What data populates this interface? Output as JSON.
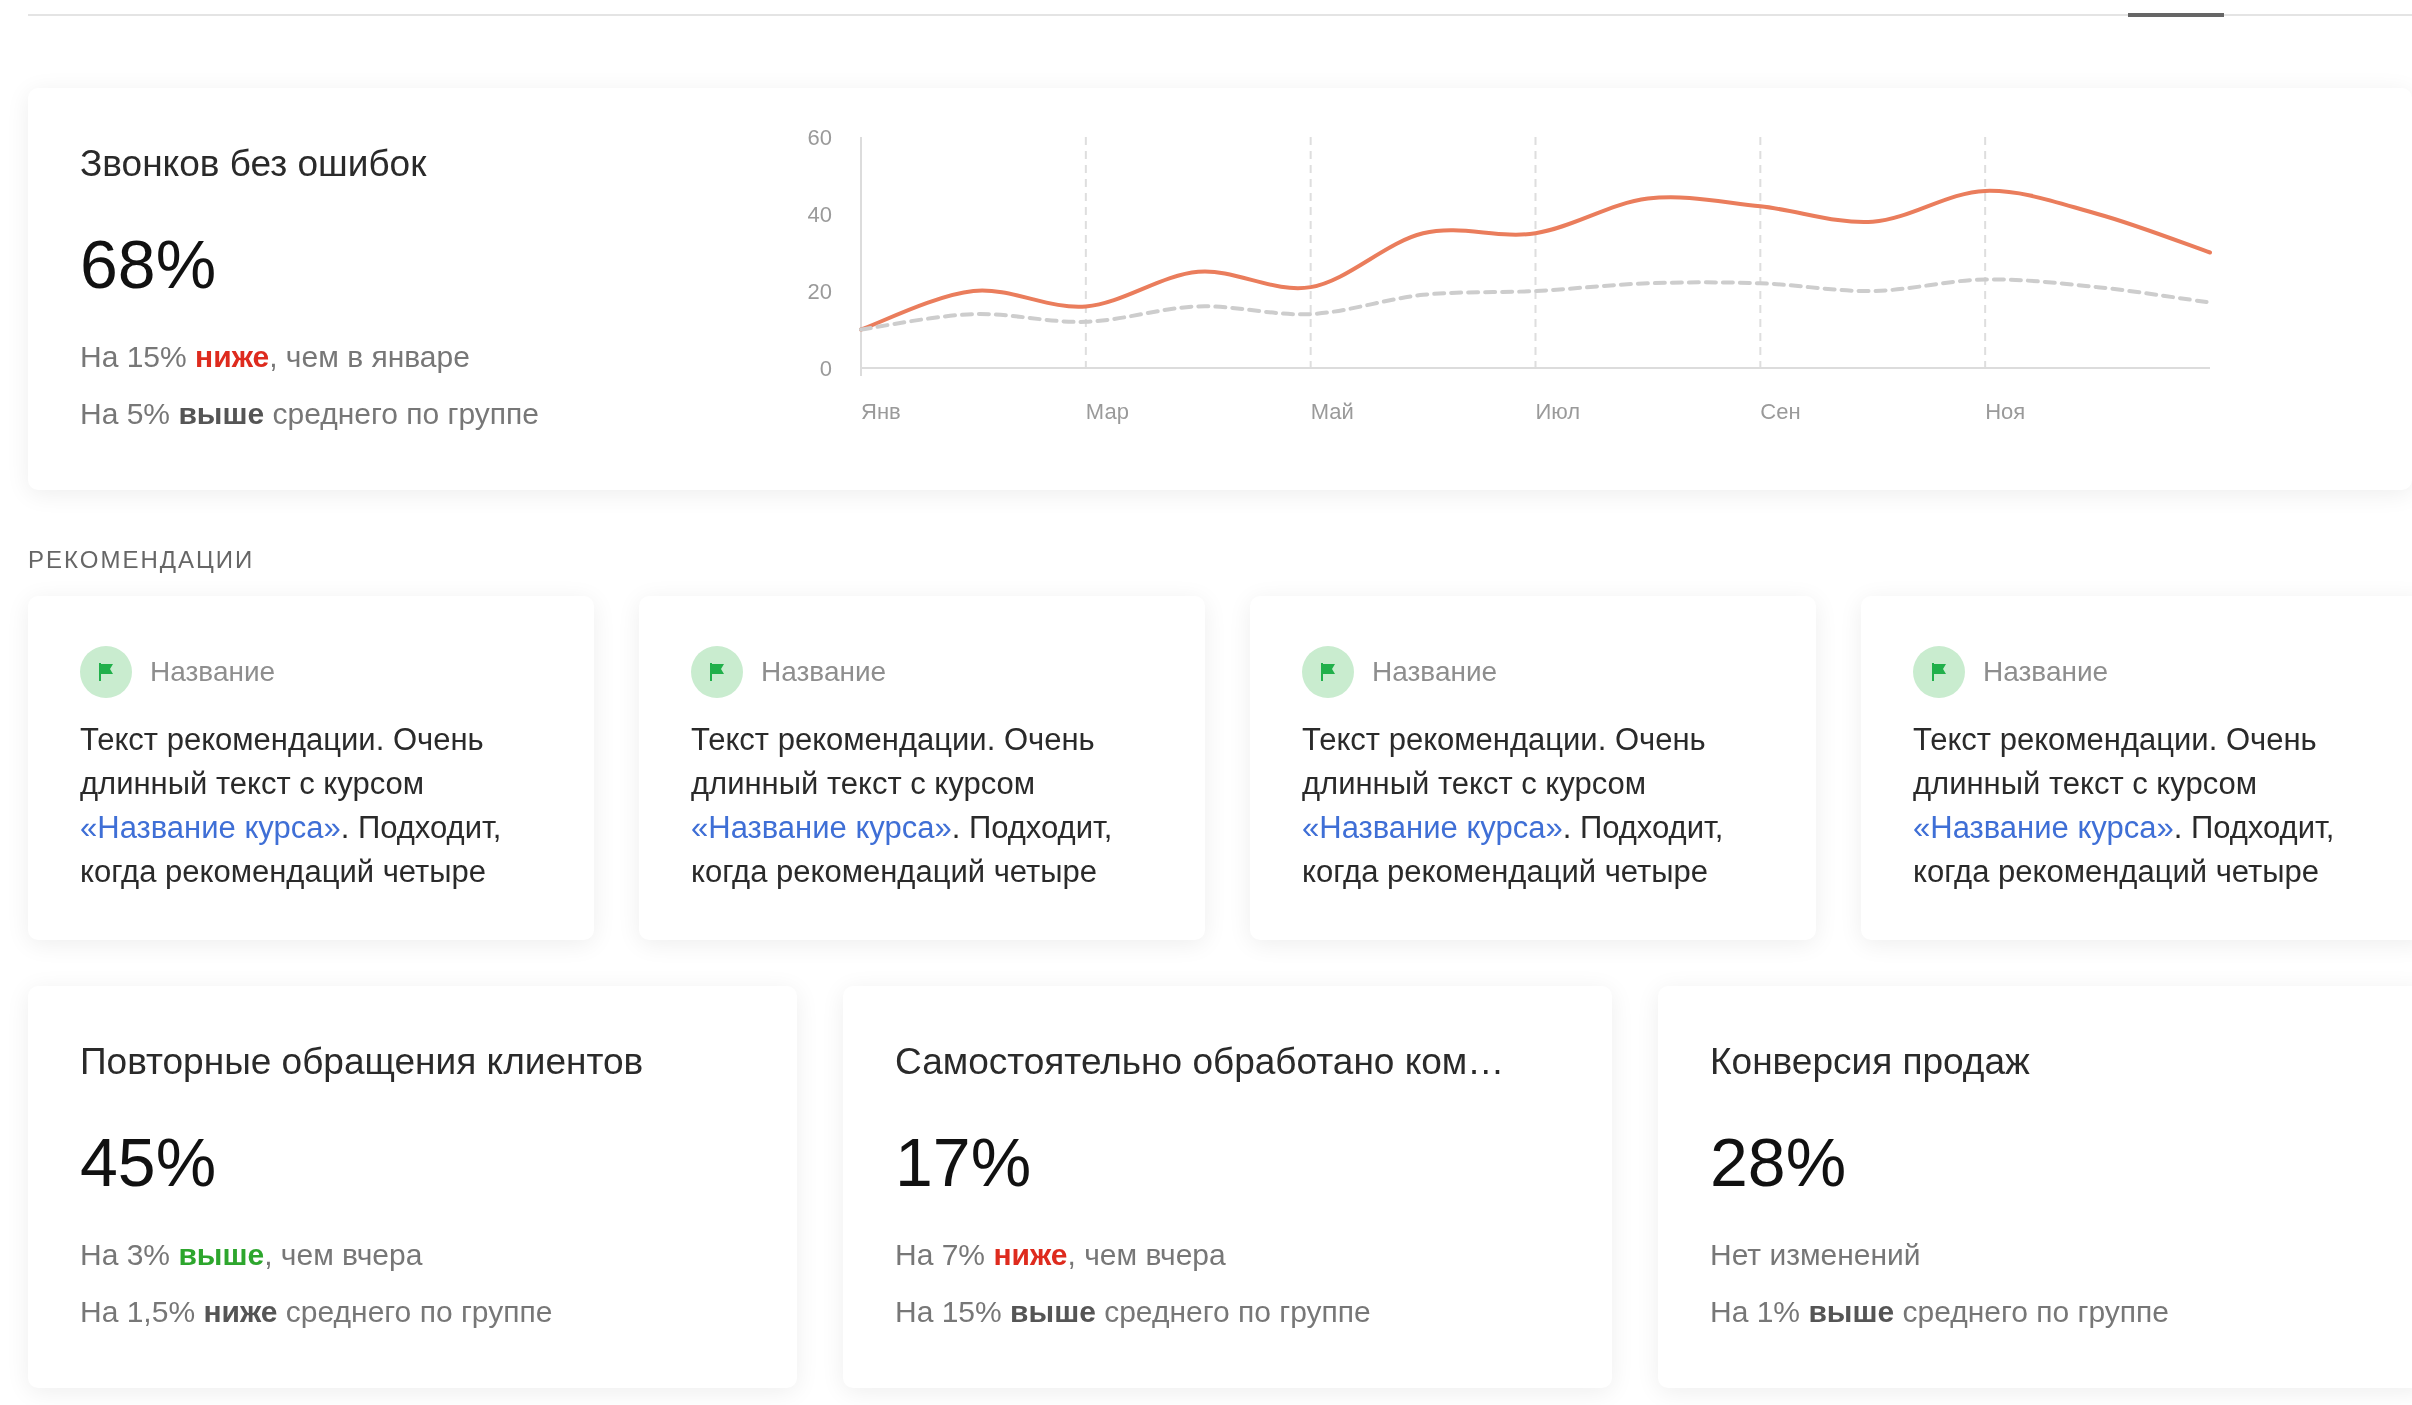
{
  "main_metric": {
    "title": "Звонков без ошибок",
    "value": "68%",
    "change": {
      "text": "На 15% **ниже**, чем в январе",
      "color": "#de2b1e"
    },
    "group": "На 5% **выше** среднего по группе",
    "chart_data": {
      "type": "line",
      "categories": [
        "Янв",
        null,
        "Мар",
        null,
        "Май",
        null,
        "Июл",
        null,
        "Сен",
        null,
        "Ноя",
        null,
        null
      ],
      "ylim": [
        0,
        60
      ],
      "yticks": [
        0,
        20,
        40,
        60
      ],
      "series": [
        {
          "color": "#ea7d5c",
          "line_style": "solid",
          "values": [
            10,
            20,
            16,
            25,
            21,
            35,
            35,
            44,
            42,
            38,
            46,
            40,
            30
          ]
        },
        {
          "color": "#cdcdcd",
          "line_style": "dashed",
          "values": [
            10,
            14,
            12,
            16,
            14,
            19,
            20,
            22,
            22,
            20,
            23,
            21,
            17
          ]
        }
      ]
    }
  },
  "recommendations_label": "РЕКОМЕНДАЦИИ",
  "recommendations": [
    {
      "title": "Название",
      "text_before": "Текст рекомендации. Очень длинный текст с курсом ",
      "link": "«Название курса»",
      "text_after": ". Подходит, когда рекомендаций четыре"
    },
    {
      "title": "Название",
      "text_before": "Текст рекомендации. Очень длинный текст с курсом ",
      "link": "«Название курса»",
      "text_after": ". Подходит, когда рекомендаций четыре"
    },
    {
      "title": "Название",
      "text_before": "Текст рекомендации. Очень длинный текст с курсом ",
      "link": "«Название курса»",
      "text_after": ". Подходит, когда рекомендаций четыре"
    },
    {
      "title": "Название",
      "text_before": "Текст рекомендации. Очень длинный текст с курсом ",
      "link": "«Название курса»",
      "text_after": ". Подходит, когда рекомендаций четыре"
    }
  ],
  "metrics": [
    {
      "title": "Повторные обращения клиентов",
      "value": "45%",
      "change": {
        "text": "На 3% **выше**, чем вчера",
        "color": "#2da62d"
      },
      "group": "На 1,5% **ниже** среднего по группе"
    },
    {
      "title": "Самостоятельно обработано ком…",
      "value": "17%",
      "change": {
        "text": "На 7% **ниже**, чем вчера",
        "color": "#de2b1e"
      },
      "group": "На 15% **выше** среднего по группе"
    },
    {
      "title": "Конверсия продаж",
      "value": "28%",
      "change": {
        "text": "Нет изменений"
      },
      "group": "На 1% **выше** среднего по группе"
    }
  ]
}
